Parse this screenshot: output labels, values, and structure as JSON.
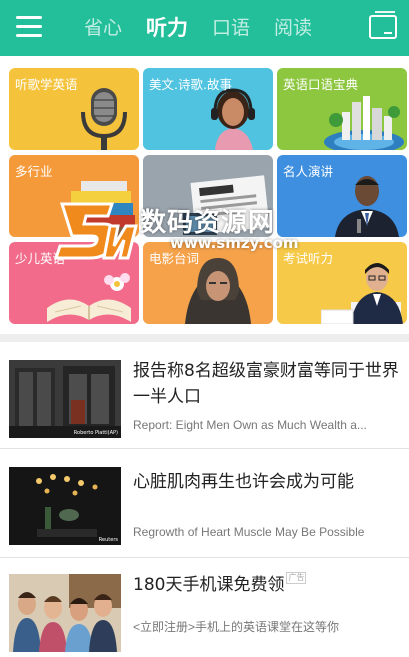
{
  "header": {
    "tabs": [
      {
        "label": "省心"
      },
      {
        "label": "听力"
      },
      {
        "label": "口语"
      },
      {
        "label": "阅读"
      }
    ],
    "active_tab": "听力",
    "background_color": "#22bf9a"
  },
  "categories": [
    {
      "label": "听歌学英语",
      "color": "#f5c33b",
      "icon": "microphone-icon"
    },
    {
      "label": "美文.诗歌.故事",
      "color": "#4fc3df",
      "icon": "woman-headphones-icon"
    },
    {
      "label": "英语口语宝典",
      "color": "#8dc63f",
      "icon": "globe-city-icon"
    },
    {
      "label": "多行业",
      "color": "#f59a3b",
      "icon": "books-icon"
    },
    {
      "label": "",
      "color": "#9aa4ad",
      "icon": "newspaper-icon"
    },
    {
      "label": "名人演讲",
      "color": "#3f8fe0",
      "icon": "speaker-icon"
    },
    {
      "label": "少儿英语",
      "color": "#f26b8a",
      "icon": "open-book-icon"
    },
    {
      "label": "电影台词",
      "color": "#f5a24b",
      "icon": "hooded-man-icon"
    },
    {
      "label": "考试听力",
      "color": "#f7c948",
      "icon": "student-icon"
    }
  ],
  "articles": [
    {
      "title": "报告称8名超级富豪财富等同于世界一半人口",
      "subtitle": "Report: Eight Men Own as Much Wealth a...",
      "thumb_caption": "Roberto Piatti(AP)",
      "is_ad": false
    },
    {
      "title": "心脏肌肉再生也许会成为可能",
      "subtitle": "Regrowth of Heart Muscle May Be Possible",
      "thumb_caption": "Reuters",
      "is_ad": false
    },
    {
      "title": "180天手机课免费领",
      "subtitle": "<立即注册>手机上的英语课堂在这等你",
      "ad_label": "广告",
      "is_ad": true
    }
  ],
  "watermark": {
    "text": "数码资源网",
    "url": "www.smzy.com"
  }
}
